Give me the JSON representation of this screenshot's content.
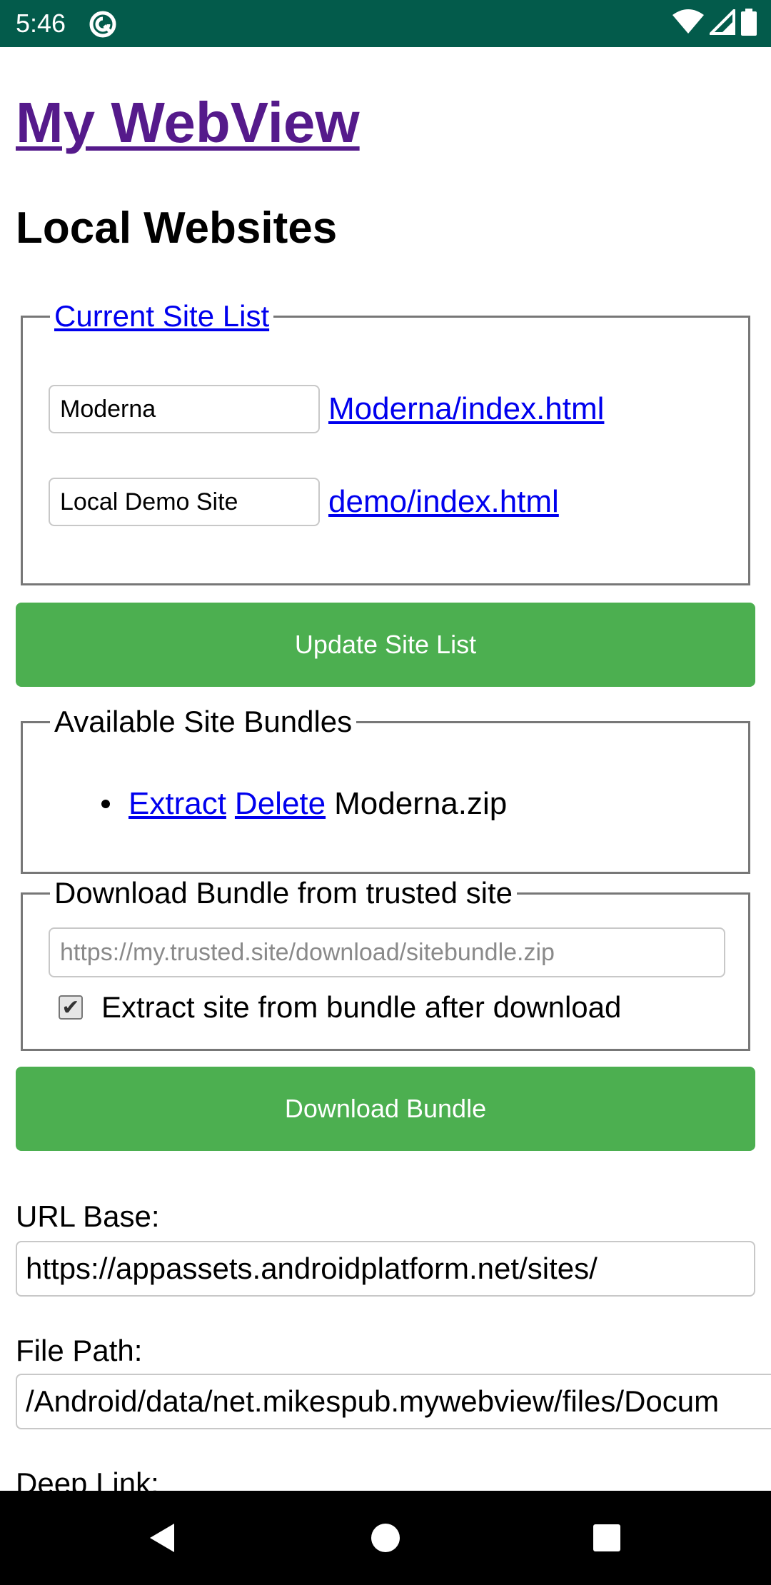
{
  "status_bar": {
    "time": "5:46",
    "icons": [
      "at-sign-notification-icon",
      "wifi-icon",
      "signal-icon",
      "battery-icon"
    ],
    "background": "#035b4b"
  },
  "page": {
    "title": "My WebView",
    "section_heading": "Local Websites"
  },
  "current_site_list": {
    "legend": "Current Site List",
    "sites": [
      {
        "name": "Moderna",
        "path": "Moderna/index.html"
      },
      {
        "name": "Local Demo Site",
        "path": "demo/index.html"
      }
    ]
  },
  "update_button": {
    "label": "Update Site List",
    "color": "#4caf50"
  },
  "available_bundles": {
    "legend": "Available Site Bundles",
    "items": [
      {
        "extract_label": "Extract",
        "delete_label": "Delete",
        "file": "Moderna.zip"
      }
    ]
  },
  "download_bundle": {
    "legend": "Download Bundle from trusted site",
    "url_placeholder": "https://my.trusted.site/download/sitebundle.zip",
    "extract_checkbox_label": "Extract site from bundle after download",
    "extract_checked": true,
    "button_label": "Download Bundle"
  },
  "settings": {
    "url_base_label": "URL Base:",
    "url_base_value": "https://appassets.androidplatform.net/sites/",
    "file_path_label": "File Path:",
    "file_path_value": "/Android/data/net.mikespub.mywebview/files/Docum",
    "deep_link_label": "Deep Link:"
  },
  "nav_bar": {
    "icons": [
      "back-icon",
      "home-icon",
      "recents-icon"
    ]
  }
}
